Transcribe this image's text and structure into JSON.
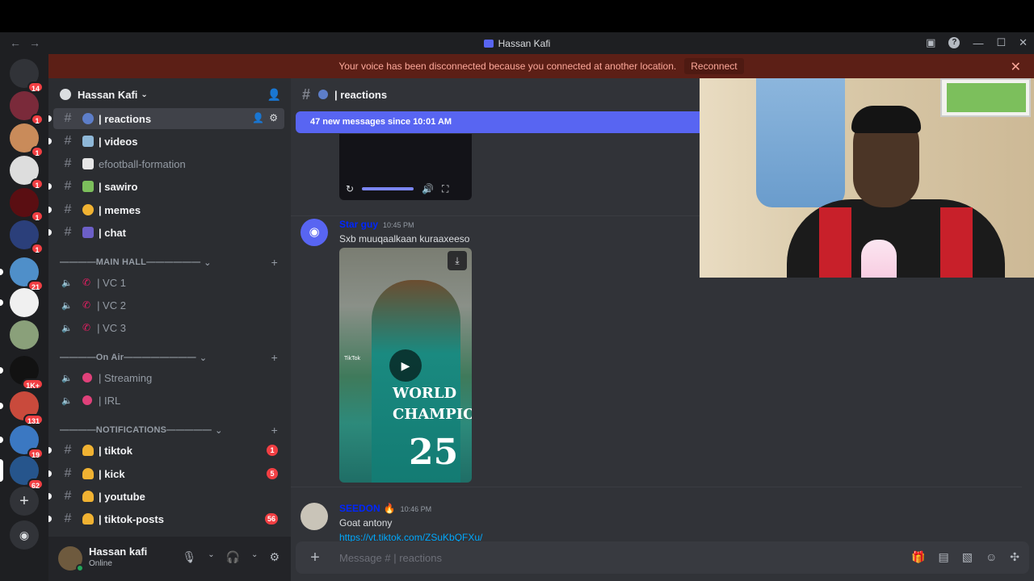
{
  "window": {
    "title": "Hassan Kafi"
  },
  "banner": {
    "message": "Your voice has been disconnected because you connected at another location.",
    "action": "Reconnect"
  },
  "guilds": [
    {
      "badge": "14"
    },
    {
      "badge": "1"
    },
    {
      "badge": "1"
    },
    {
      "badge": "1"
    },
    {
      "badge": "1"
    },
    {
      "badge": "1"
    },
    {
      "badge": "21"
    },
    {
      "badge": ""
    },
    {
      "badge": ""
    },
    {
      "badge": "1K+"
    },
    {
      "badge": "131"
    },
    {
      "badge": "19"
    },
    {
      "badge": "62"
    }
  ],
  "server": {
    "name": "Hassan Kafi"
  },
  "channels": [
    {
      "name": "| reactions"
    },
    {
      "name": "| videos"
    },
    {
      "name": "efootball-formation"
    },
    {
      "name": "| sawiro"
    },
    {
      "name": "| memes"
    },
    {
      "name": "| chat"
    }
  ],
  "categories": {
    "main_hall": "————MAIN HALL—————— ",
    "on_air": "————On Air————————",
    "notifications": "————NOTIFICATIONS————— "
  },
  "voice_main": [
    "| VC 1",
    "| VC 2",
    "| VC 3"
  ],
  "voice_on_air": [
    "| Streaming",
    "| IRL"
  ],
  "notif_channels": [
    {
      "name": "| tiktok",
      "count": "1"
    },
    {
      "name": "| kick",
      "count": "5"
    },
    {
      "name": "| youtube",
      "count": ""
    },
    {
      "name": "| tiktok-posts",
      "count": "56"
    }
  ],
  "user": {
    "name": "Hassan kafi",
    "status": "Online"
  },
  "chat": {
    "channel": "| reactions",
    "new_messages": "47 new messages since 10:01 AM",
    "messages": [
      {
        "author": "Star guy",
        "time": "10:45 PM",
        "text": "Sxb muuqaalkaan kuraaxeeso"
      },
      {
        "author": "SEEDON",
        "time": "10:46 PM",
        "text": "Goat antony",
        "link": "https://vt.tiktok.com/ZSuKbQFXu/"
      }
    ],
    "video_text": {
      "line1": "WORLD",
      "line2": "CHAMPION",
      "number": "25",
      "source": "TikTok"
    },
    "composer_placeholder": "Message # | reactions"
  },
  "colors": {
    "accent": "#5865f2",
    "banner": "#5c1f16",
    "danger": "#f23f43"
  }
}
